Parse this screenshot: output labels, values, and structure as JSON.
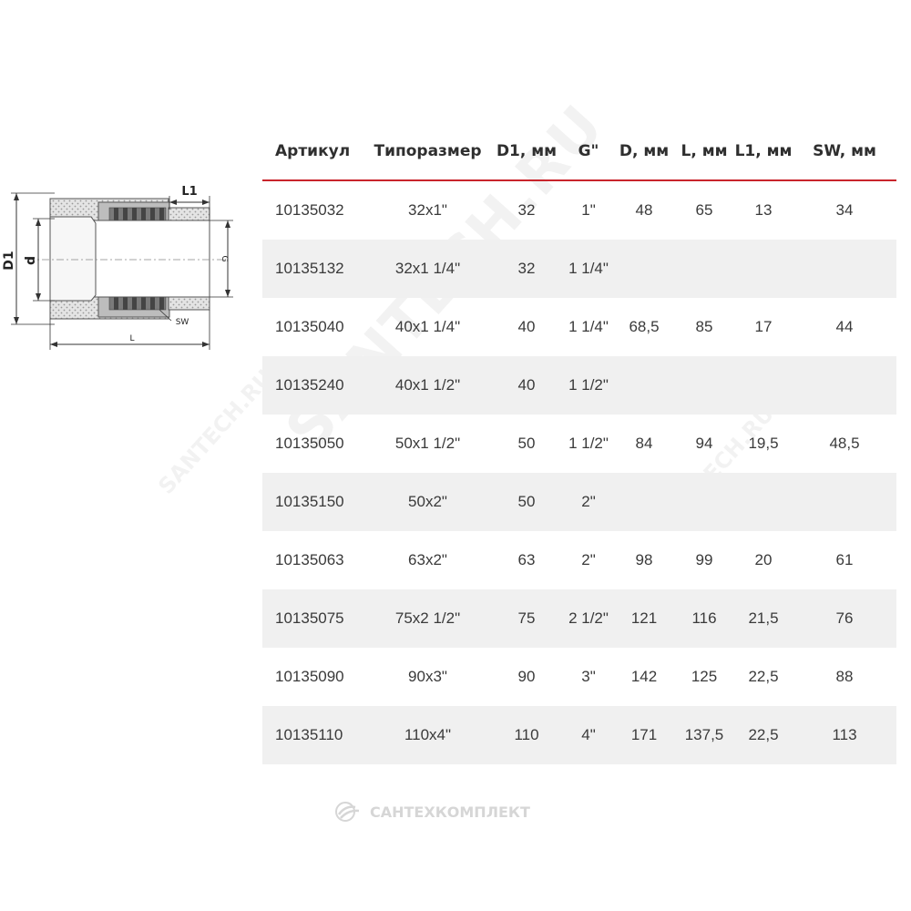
{
  "drawing": {
    "label_D1": "D1",
    "label_d": "d",
    "label_L1": "L1",
    "label_G": "G",
    "label_SW": "SW",
    "label_L": "L"
  },
  "table": {
    "headers": [
      "Артикул",
      "Типоразмер",
      "D1, мм",
      "G\"",
      "D, мм",
      "L, мм",
      "L1, мм",
      "SW, мм"
    ],
    "rows": [
      [
        "10135032",
        "32x1\"",
        "32",
        "1\"",
        "48",
        "65",
        "13",
        "34"
      ],
      [
        "10135132",
        "32x1 1/4\"",
        "32",
        "1 1/4\"",
        "",
        "",
        "",
        ""
      ],
      [
        "10135040",
        "40x1 1/4\"",
        "40",
        "1 1/4\"",
        "68,5",
        "85",
        "17",
        "44"
      ],
      [
        "10135240",
        "40x1 1/2\"",
        "40",
        "1 1/2\"",
        "",
        "",
        "",
        ""
      ],
      [
        "10135050",
        "50x1 1/2\"",
        "50",
        "1 1/2\"",
        "84",
        "94",
        "19,5",
        "48,5"
      ],
      [
        "10135150",
        "50x2\"",
        "50",
        "2\"",
        "",
        "",
        "",
        ""
      ],
      [
        "10135063",
        "63x2\"",
        "63",
        "2\"",
        "98",
        "99",
        "20",
        "61"
      ],
      [
        "10135075",
        "75x2 1/2\"",
        "75",
        "2 1/2\"",
        "121",
        "116",
        "21,5",
        "76"
      ],
      [
        "10135090",
        "90x3\"",
        "90",
        "3\"",
        "142",
        "125",
        "22,5",
        "88"
      ],
      [
        "10135110",
        "110x4\"",
        "110",
        "4\"",
        "171",
        "137,5",
        "22,5",
        "113"
      ]
    ]
  },
  "watermarks": {
    "main": "SANTECH.RU",
    "small_left": "SANTECH.RU",
    "small_right": "SANTECH.RU"
  },
  "footer": {
    "logo_text": "САНТЕХКОМПЛЕКТ"
  },
  "colors": {
    "accent": "#c9252c",
    "stripe": "#f0f0f0"
  }
}
